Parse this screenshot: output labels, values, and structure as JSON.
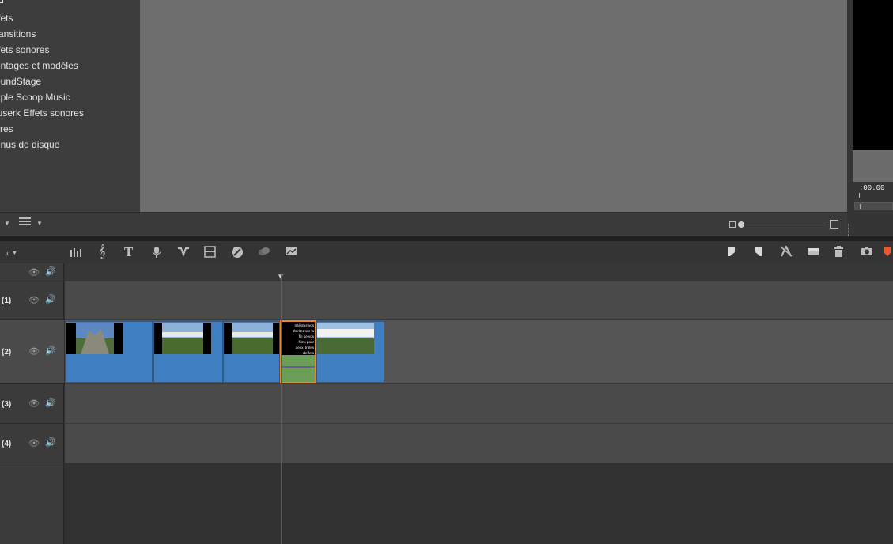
{
  "library": {
    "items": [
      {
        "label": "ffets"
      },
      {
        "label": "ransitions"
      },
      {
        "label": "ffets sonores"
      },
      {
        "label": "ontages et modèles"
      },
      {
        "label": "oundStage"
      },
      {
        "label": "riple Scoop Music"
      },
      {
        "label": "luserk Effets sonores"
      },
      {
        "label": "itres"
      },
      {
        "label": "enus de disque"
      }
    ]
  },
  "preview": {
    "timecode": ":00.00"
  },
  "timeline": {
    "tracks": [
      {
        "label": "(1)"
      },
      {
        "label": "(2)"
      },
      {
        "label": "(3)"
      },
      {
        "label": "(4)"
      }
    ],
    "title_clip_text": [
      "Intégrez vos",
      "Écritez sur la",
      "fin de vos",
      "films pour",
      "deux drôles",
      "d'effets"
    ]
  },
  "icons": {
    "toolbar_left": [
      "audio-mixer-icon",
      "music-note-icon",
      "title-icon",
      "microphone-icon",
      "transition-icon",
      "montage-icon",
      "color-icon",
      "effects-icon",
      "chart-icon"
    ],
    "toolbar_right": [
      "marker-left-icon",
      "marker-right-icon",
      "razor-icon",
      "snapshot-icon",
      "delete-icon",
      "camera-icon",
      "record-icon"
    ]
  },
  "colors": {
    "clip_blue": "#3f7ec0",
    "selected_clip_border": "#e98a2a",
    "playhead": "#c9302c"
  }
}
